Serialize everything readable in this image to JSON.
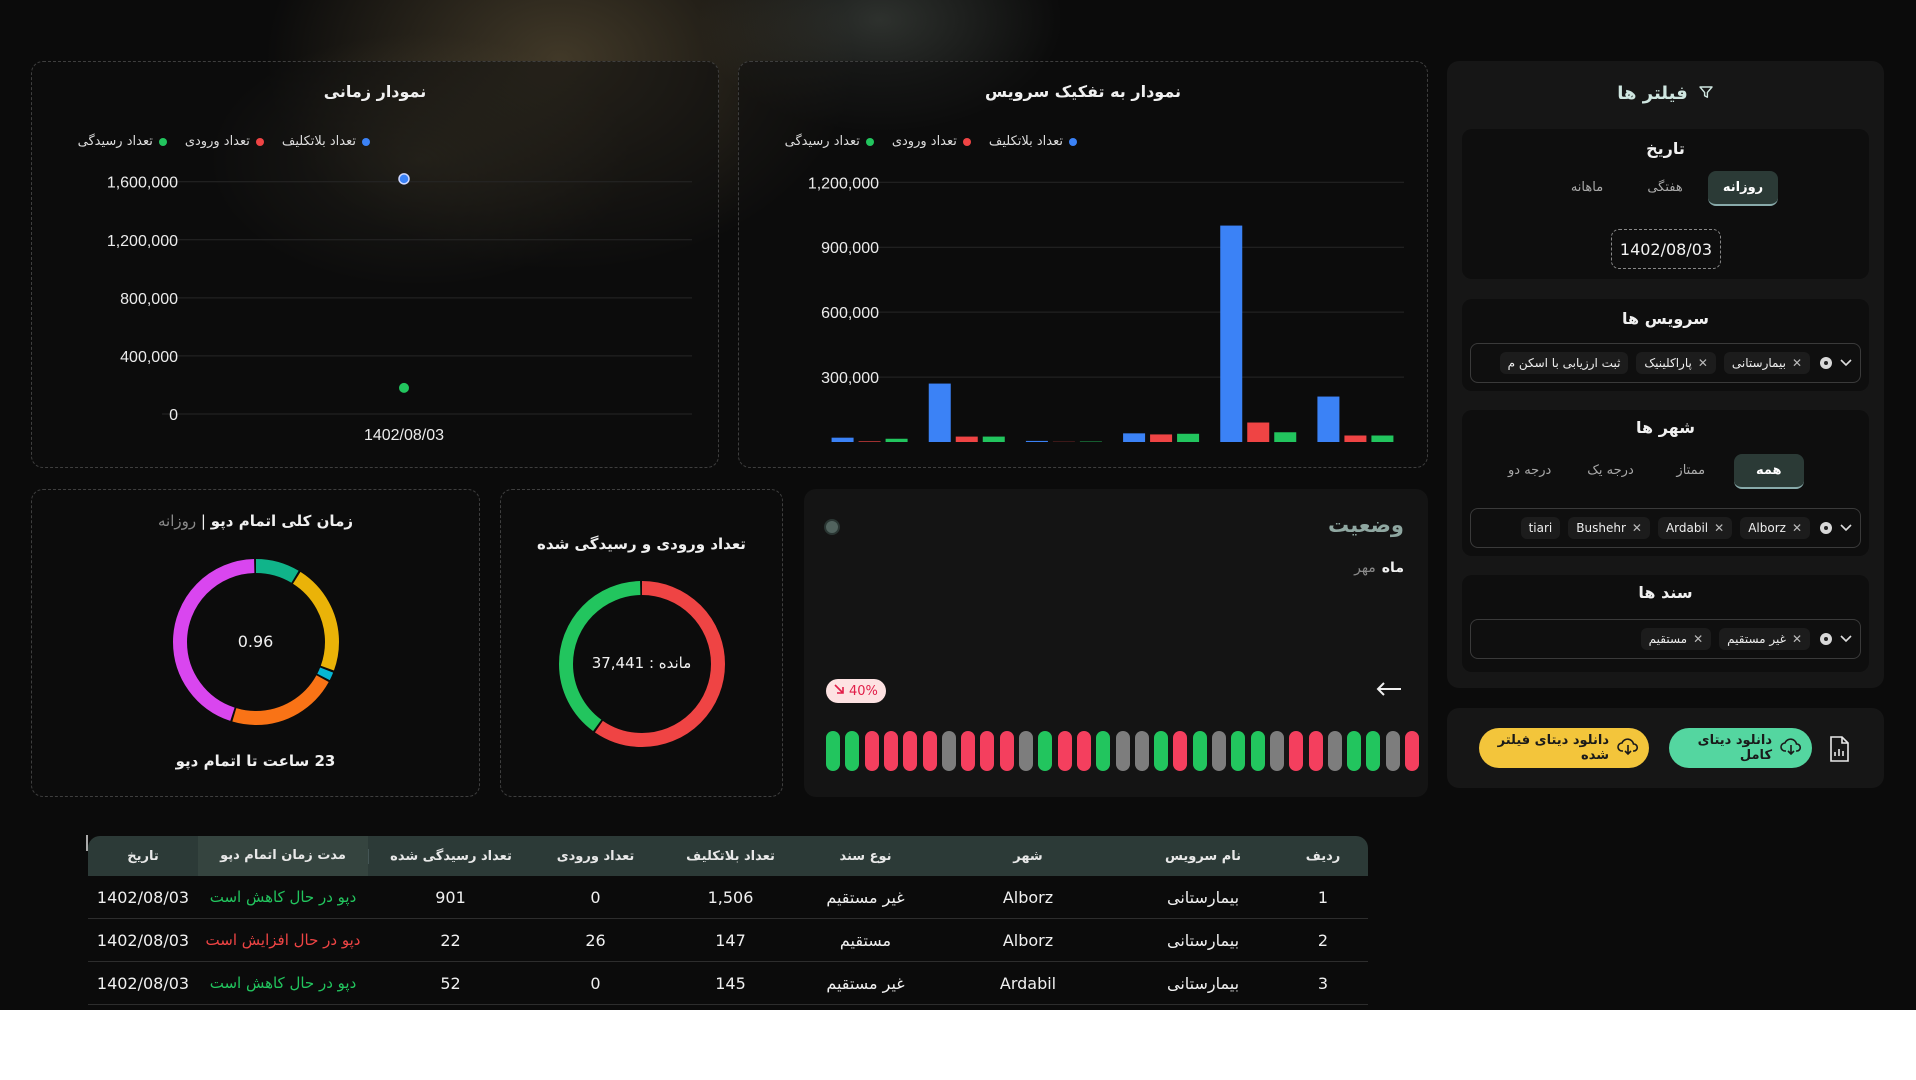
{
  "filters": {
    "title": "فیلتر ها",
    "date": {
      "title": "تاریخ",
      "options": [
        "روزانه",
        "هفتگی",
        "ماهانه"
      ],
      "selected": "روزانه",
      "value": "1402/08/03"
    },
    "services": {
      "title": "سرویس ها",
      "chips": [
        "بیمارستانی",
        "پاراکلینیک",
        "ثبت ارزیابی با اسکن م"
      ]
    },
    "cities": {
      "title": "شهر ها",
      "options": [
        "همه",
        "ممتاز",
        "درجه یک",
        "درجه دو"
      ],
      "selected": "همه",
      "chips": [
        "Alborz",
        "Ardabil",
        "Bushehr",
        "tiari"
      ]
    },
    "documents": {
      "title": "سند ها",
      "chips": [
        "غیر مستقیم",
        "مستقیم"
      ]
    },
    "download_full": "دانلود دیتای کامل",
    "download_filtered": "دانلود دیتای فیلتر شده"
  },
  "service_chart": {
    "title": "نمودار به تفکیک سرویس",
    "legend": [
      "تعداد بلاتکلیف",
      "تعداد ورودی",
      "تعداد رسیدگی"
    ]
  },
  "time_chart": {
    "title": "نمودار زمانی",
    "legend": [
      "تعداد بلاتکلیف",
      "تعداد ورودی",
      "تعداد رسیدگی"
    ]
  },
  "colors": {
    "blue": "#3b82f6",
    "red": "#ef4444",
    "green": "#22c55e",
    "gray": "#7a7a7a"
  },
  "chart_data": [
    {
      "type": "bar",
      "title": "نمودار به تفکیک سرویس",
      "ylim": [
        0,
        1200000
      ],
      "yticks": [
        "1,200,000",
        "900,000",
        "600,000",
        "300,000"
      ],
      "legend": "top-right",
      "categories": [
        "",
        "",
        "",
        "",
        "",
        ""
      ],
      "series": [
        {
          "name": "تعداد بلاتکلیف",
          "color": "#3b82f6",
          "values": [
            20000,
            270000,
            5000,
            40000,
            1000000,
            210000
          ]
        },
        {
          "name": "تعداد ورودی",
          "color": "#ef4444",
          "values": [
            3000,
            25000,
            1000,
            35000,
            90000,
            30000
          ]
        },
        {
          "name": "تعداد رسیدگی",
          "color": "#22c55e",
          "values": [
            15000,
            25000,
            2000,
            38000,
            45000,
            30000
          ]
        }
      ]
    },
    {
      "type": "scatter",
      "title": "نمودار زمانی",
      "x": [
        "1402/08/03"
      ],
      "ylim": [
        0,
        1600000
      ],
      "yticks": [
        "1,600,000",
        "1,200,000",
        "800,000",
        "400,000",
        "0"
      ],
      "legend": "top-right",
      "series": [
        {
          "name": "تعداد بلاتکلیف",
          "color": "#3b82f6",
          "values": [
            1620000
          ]
        },
        {
          "name": "تعداد رسیدگی",
          "color": "#22c55e",
          "values": [
            180000
          ]
        }
      ]
    },
    {
      "type": "pie",
      "title": "تعداد ورودی و رسیدگی شده",
      "center_label": "مانده : 37,441",
      "slices": [
        {
          "color": "#ef4444",
          "value": 0.6
        },
        {
          "color": "#22c55e",
          "value": 0.4
        }
      ]
    },
    {
      "type": "pie",
      "title": "زمان کلی اتمام دپو",
      "subtitle": "روزانه",
      "center_label": "0.96",
      "footer": "23 ساعت تا اتمام دپو",
      "slices": [
        {
          "color": "#10b48a",
          "value": 0.09
        },
        {
          "color": "#eab308",
          "value": 0.22
        },
        {
          "color": "#06b6d4",
          "value": 0.02
        },
        {
          "color": "#f97316",
          "value": 0.22
        },
        {
          "color": "#d946ef",
          "value": 0.45
        }
      ]
    }
  ],
  "status": {
    "title": "وضعیت",
    "period_label": "ماه",
    "period_value": "مهر",
    "badge": "40%",
    "pills": [
      "green",
      "green",
      "red",
      "red",
      "red",
      "red",
      "gray",
      "red",
      "red",
      "red",
      "gray",
      "green",
      "red",
      "red",
      "green",
      "gray",
      "gray",
      "green",
      "red",
      "green",
      "gray",
      "green",
      "green",
      "gray",
      "red",
      "red",
      "gray",
      "green",
      "green",
      "gray",
      "red"
    ]
  },
  "donut_in": {
    "title": "تعداد ورودی و رسیدگی شده",
    "center": "مانده : 37,441"
  },
  "donut_depo": {
    "title": "زمان کلی اتمام دپو",
    "sep": "|",
    "subtitle": "روزانه",
    "center": "0.96",
    "footer": "23 ساعت تا اتمام دپو"
  },
  "table": {
    "headers": [
      "ردیف",
      "نام سرویس",
      "شهر",
      "نوع سند",
      "تعداد بلاتکلیف",
      "تعداد ورودی",
      "تعداد رسیدگی شده",
      "مدت زمان اتمام دپو",
      "تاریخ"
    ],
    "rows": [
      [
        "1",
        "بیمارستانی",
        "Alborz",
        "غیر مستقیم",
        "1,506",
        "0",
        "901",
        "دپو در حال کاهش است",
        "1402/08/03"
      ],
      [
        "2",
        "بیمارستانی",
        "Alborz",
        "مستقیم",
        "147",
        "26",
        "22",
        "دپو در حال افزایش است",
        "1402/08/03"
      ],
      [
        "3",
        "بیمارستانی",
        "Ardabil",
        "غیر مستقیم",
        "145",
        "0",
        "52",
        "دپو در حال کاهش است",
        "1402/08/03"
      ]
    ],
    "row_trend": [
      "down",
      "up",
      "down"
    ]
  }
}
